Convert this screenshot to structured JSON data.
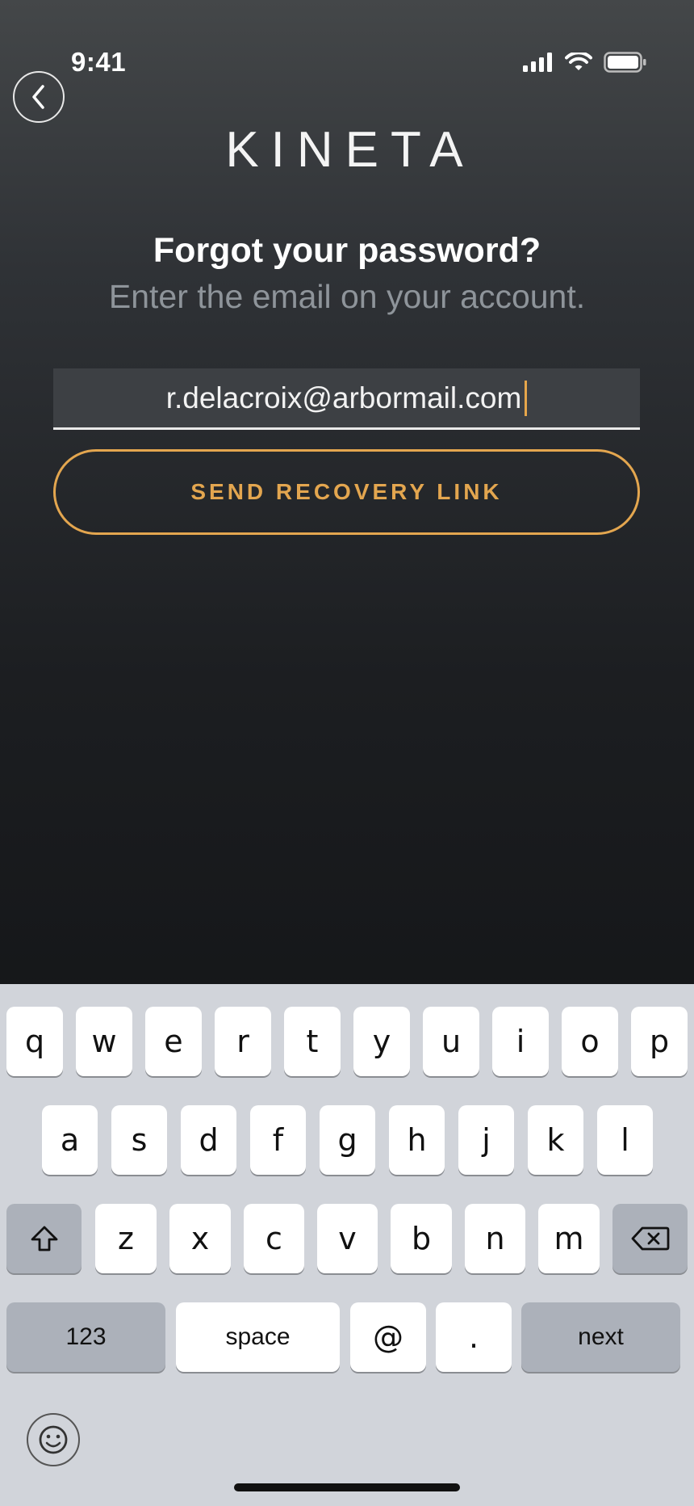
{
  "status_bar": {
    "time": "9:41"
  },
  "header": {
    "logo": "KINETA"
  },
  "content": {
    "title": "Forgot your password?",
    "subtitle": "Enter the email on your account.",
    "email_value": "r.delacroix@arbormail.com",
    "send_button_label": "SEND RECOVERY LINK"
  },
  "keyboard": {
    "row1": [
      "q",
      "w",
      "e",
      "r",
      "t",
      "y",
      "u",
      "i",
      "o",
      "p"
    ],
    "row2": [
      "a",
      "s",
      "d",
      "f",
      "g",
      "h",
      "j",
      "k",
      "l"
    ],
    "row3": [
      "z",
      "x",
      "c",
      "v",
      "b",
      "n",
      "m"
    ],
    "row4": {
      "numbers": "123",
      "space": "space",
      "at": "@",
      "dot": ".",
      "next": "next"
    }
  },
  "colors": {
    "accent": "#e3a64f",
    "background_top": "#444749",
    "background_bottom": "#0b0c0e",
    "keyboard_bg": "#d1d4da"
  }
}
